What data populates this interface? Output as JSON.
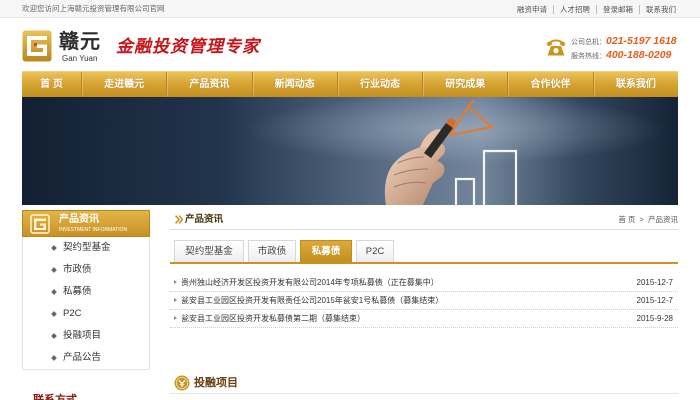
{
  "topbar": {
    "welcome": "欢迎您访问上海赣元投资管理有限公司官网",
    "links": [
      "融资申请",
      "人才招聘",
      "登录邮箱",
      "联系我们"
    ]
  },
  "header": {
    "brand_cn": "赣元",
    "brand_en": "Gan Yuan",
    "slogan": "金融投资管理专家",
    "hotlines": [
      {
        "label": "公司总机：",
        "number": "021-5197 1618"
      },
      {
        "label": "服务热线：",
        "number": "400-188-0209"
      }
    ]
  },
  "nav": [
    "首 页",
    "走进赣元",
    "产品资讯",
    "新闻动态",
    "行业动态",
    "研究成果",
    "合作伙伴",
    "联系我们"
  ],
  "sidebar": {
    "title": "产品资讯",
    "subtitle": "INVESTMENT INFORMATION",
    "items": [
      "契约型基金",
      "市政债",
      "私募债",
      "P2C",
      "投融项目",
      "产品公告"
    ],
    "next_section_title": "联系方式"
  },
  "main": {
    "title": "产品资讯",
    "breadcrumb": {
      "home": "首 页",
      "separator": ">",
      "current": "产品资讯"
    },
    "tabs": [
      {
        "label": "契约型基金",
        "active": false
      },
      {
        "label": "市政债",
        "active": false
      },
      {
        "label": "私募债",
        "active": true
      },
      {
        "label": "P2C",
        "active": false
      }
    ],
    "items": [
      {
        "title": "贵州独山经济开发区投资开发有限公司2014年专项私募债（正在募集中）",
        "date": "2015-12-7"
      },
      {
        "title": "瓮安县工业园区投资开发有限责任公司2015年瓮安1号私募债（募集结束）",
        "date": "2015-12-7"
      },
      {
        "title": "瓮安县工业园区投资开发私募债第二期（募集结束）",
        "date": "2015-9-28"
      }
    ],
    "next_section_title": "投融项目"
  },
  "colors": {
    "accent_gold": "#c8951e",
    "gold_light": "#e8bb4f",
    "gold_dark": "#b07d14",
    "slogan_red": "#c4161c",
    "hotline_orange": "#e4601a",
    "text": "#333333"
  },
  "icons": {
    "logo": "gan-yuan-logo-icon",
    "hotline": "phone-icon",
    "sidebar_header": "gan-yuan-logo-icon",
    "sidebar_bullet": "diamond-bullet-icon",
    "title_marker": "double-chevron-icon",
    "list_bullet": "triangle-bullet-icon",
    "section_badge": "coin-badge-icon"
  }
}
